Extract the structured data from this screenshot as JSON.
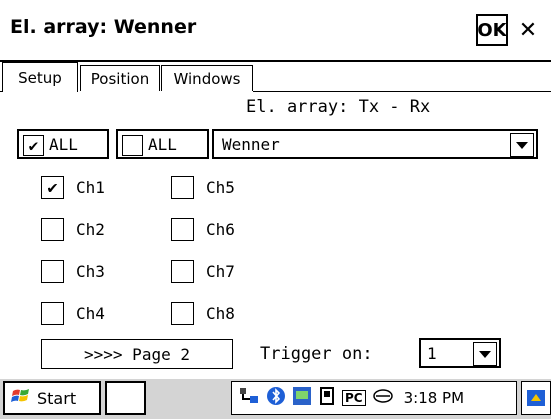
{
  "window": {
    "title": "El. array: Wenner",
    "ok_label": "OK",
    "close_glyph": "✕"
  },
  "tabs": [
    {
      "label": "Setup",
      "active": true
    },
    {
      "label": "Position",
      "active": false
    },
    {
      "label": "Windows",
      "active": false
    }
  ],
  "setup": {
    "array_label": "El. array: Tx - Rx",
    "all_checked": {
      "label": "ALL",
      "checked": true
    },
    "all_unchecked": {
      "label": "ALL",
      "checked": false
    },
    "array_select": {
      "value": "Wenner"
    },
    "channels": [
      {
        "label": "Ch1",
        "checked": true
      },
      {
        "label": "Ch2",
        "checked": false
      },
      {
        "label": "Ch3",
        "checked": false
      },
      {
        "label": "Ch4",
        "checked": false
      },
      {
        "label": "Ch5",
        "checked": false
      },
      {
        "label": "Ch6",
        "checked": false
      },
      {
        "label": "Ch7",
        "checked": false
      },
      {
        "label": "Ch8",
        "checked": false
      }
    ],
    "page_button": ">>>> Page 2",
    "trigger_label": "Trigger on:",
    "trigger_select": {
      "value": "1"
    }
  },
  "taskbar": {
    "start_label": "Start",
    "tray_icons": [
      "network-icon",
      "bluetooth-icon",
      "app-icon",
      "sync-icon",
      "pc-icon",
      "connection-icon"
    ],
    "pc_text": "PC",
    "time": "3:18 PM"
  },
  "colors": {
    "accent_blue": "#1e5fd6",
    "taskbar_gray": "#d4d4d4"
  }
}
